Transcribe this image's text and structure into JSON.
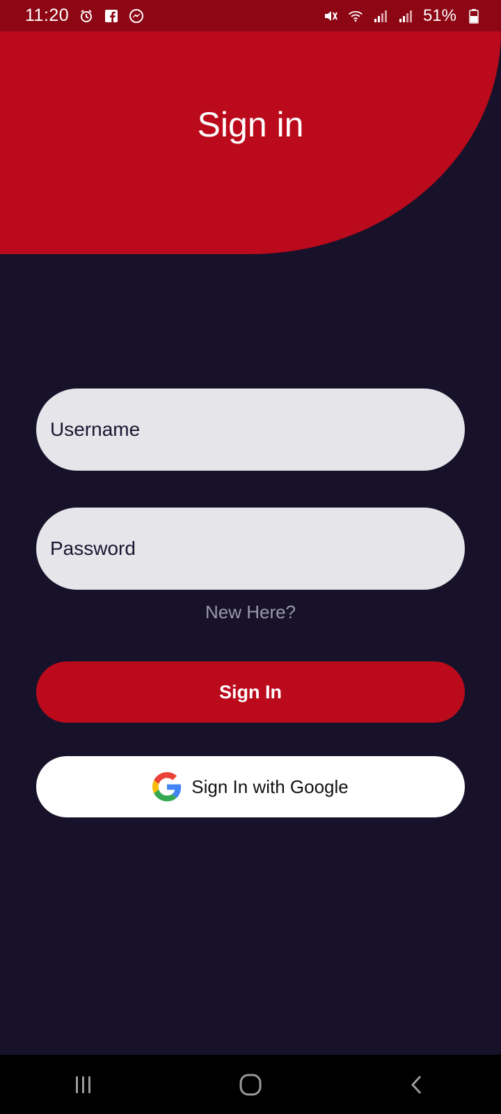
{
  "status_bar": {
    "time": "11:20",
    "battery": "51%",
    "icons": [
      "alarm-icon",
      "facebook-icon",
      "messenger-icon",
      "mute-icon",
      "wifi-icon",
      "signal-icon",
      "signal-icon",
      "battery-icon"
    ]
  },
  "header": {
    "title": "Sign in"
  },
  "form": {
    "username_placeholder": "Username",
    "username_value": "",
    "password_placeholder": "Password",
    "password_value": "",
    "new_here_link": "New Here?",
    "signin_label": "Sign In",
    "google_label": "Sign In with Google"
  },
  "nav_bar": {
    "icons": [
      "recent-apps-icon",
      "home-icon",
      "back-icon"
    ]
  },
  "colors": {
    "accent_red": "#ba0a1b",
    "status_bar_red": "#8c0614",
    "background": "#17122a",
    "field_background": "#e5e5ea"
  }
}
